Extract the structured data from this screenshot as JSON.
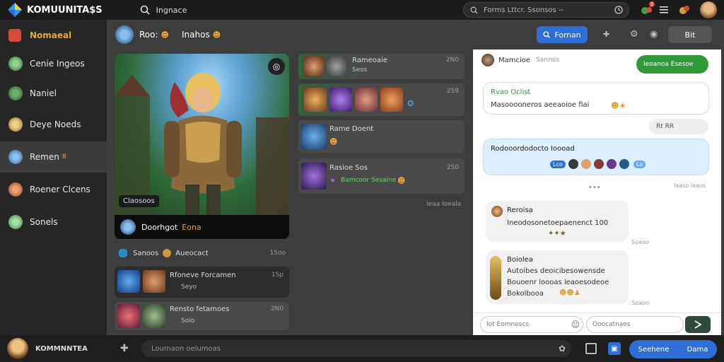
{
  "app": {
    "title": "KOMUUNITA$S"
  },
  "topbar": {
    "search_value": "Ingnace",
    "search2_value": "Forms Lttcr. Ssonsos --",
    "notif_count": "3"
  },
  "sidebar": {
    "active_item": "Nomaeal",
    "items": [
      {
        "label": "Cenie Ingeos",
        "avatar_color": "#5a8f5a"
      },
      {
        "label": "Naniel",
        "avatar_color": "#3b7a3b"
      },
      {
        "label": "Deye Noeds",
        "avatar_color": "#c9a14a"
      },
      {
        "label": "Remen",
        "badge": "8",
        "avatar_color": "#4a86c9"
      },
      {
        "label": "Roener Clcens",
        "avatar_color": "#c96b3a"
      },
      {
        "label": "Sonels",
        "avatar_color": "#6aa86a"
      }
    ]
  },
  "header": {
    "title": "Roo:",
    "subtitle": "Inahos",
    "primary_button": "Foman",
    "secondary_button": "Bit"
  },
  "featured": {
    "caption": "Claosoos",
    "title": "Doorhgot",
    "subtitle": "Eona",
    "section_label": "Sanoos",
    "section_title": "Aueocact",
    "section_meta": "1Soo"
  },
  "lower_cards": [
    {
      "name": "Rfoneve Forcamen",
      "meta": "1Sp",
      "sub": "Seyo"
    },
    {
      "name": "Rensto fetamoes",
      "meta": "2N0",
      "sub": "Soio"
    }
  ],
  "right_cards": [
    {
      "name": "Rameoaie",
      "meta": "2N0",
      "sub": "Seos"
    },
    {
      "name": "",
      "meta": "2S9",
      "sub": ""
    },
    {
      "name": "Rame Doent",
      "meta": "",
      "sub": ""
    },
    {
      "name": "Rasioe Sos",
      "meta": "2S0",
      "sub": "Bamcoor Sesaine"
    }
  ],
  "right_footer": "Ieaa Ioeala",
  "chat": {
    "header_name": "Mamcioe",
    "header_status": "Sannos",
    "tag_label": "Ieoanoa Esesoe",
    "bubble1_title": "Rvao Oclist",
    "bubble1_text": "Masooooneros aeeaoioe fiai",
    "pill_text": "Rt RR",
    "bubble2_title": "Rodooordodocto Ioooad",
    "bubble2_chip": "Lco",
    "bubble2_chip2": "Lo",
    "small_right_meta": "Iaaso Iaaos",
    "msg1_name": "Reroisa",
    "msg1_text": "Ineodosonetoepaenenct 100",
    "msg1_meta": "Soaoo",
    "msg2_name": "Boiolea",
    "msg2_lines": [
      "Autoibes deoicibesowensde",
      "Bouoenr loooas leaoesodeoe",
      "Bokolbooa"
    ],
    "msg2_meta": "Soaoo",
    "input_placeholder": "Iot Eomnescs",
    "input2_placeholder": "Ooocatnaos"
  },
  "bottombar": {
    "user_name": "KOMMNNTEA",
    "input_placeholder": "Loumaon oelumoas",
    "button_left": "Seehene",
    "button_right": "Dama"
  },
  "colors": {
    "accent_blue": "#2d6fd6",
    "accent_green": "#2f9a38",
    "active_item": "#e8a33a"
  }
}
